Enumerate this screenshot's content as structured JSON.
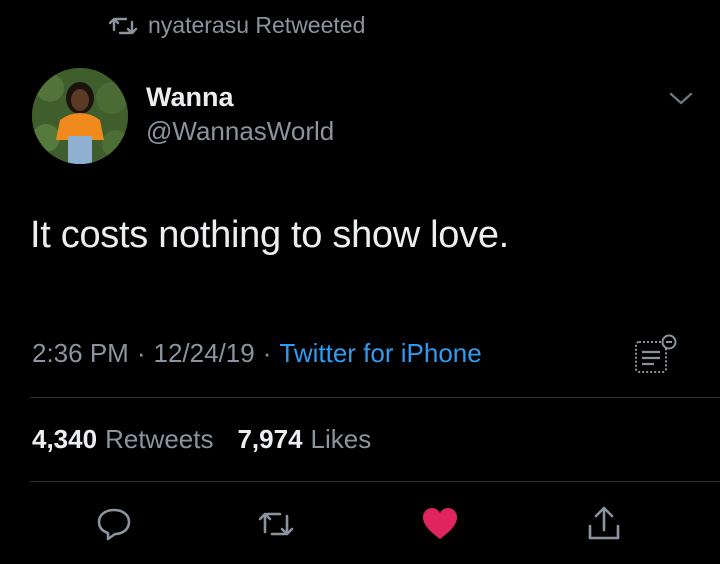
{
  "retweet_banner": {
    "text": "nyaterasu Retweeted"
  },
  "author": {
    "display_name": "Wanna",
    "handle": "@WannasWorld"
  },
  "tweet": {
    "text": "It costs nothing to show love."
  },
  "meta": {
    "time": "2:36 PM",
    "separator": "·",
    "date": "12/24/19",
    "source": "Twitter for iPhone"
  },
  "stats": {
    "retweets_count": "4,340",
    "retweets_label": "Retweets",
    "likes_count": "7,974",
    "likes_label": "Likes"
  },
  "colors": {
    "background": "#000000",
    "link": "#2f9bf0",
    "like_active": "#e0245e",
    "secondary_text": "#8b949e"
  },
  "icons": {
    "retweet_banner": "retweet-icon",
    "menu": "chevron-down-icon",
    "analytics": "analytics-icon",
    "reply": "reply-icon",
    "retweet": "retweet-icon",
    "like": "heart-icon",
    "share": "share-icon"
  }
}
